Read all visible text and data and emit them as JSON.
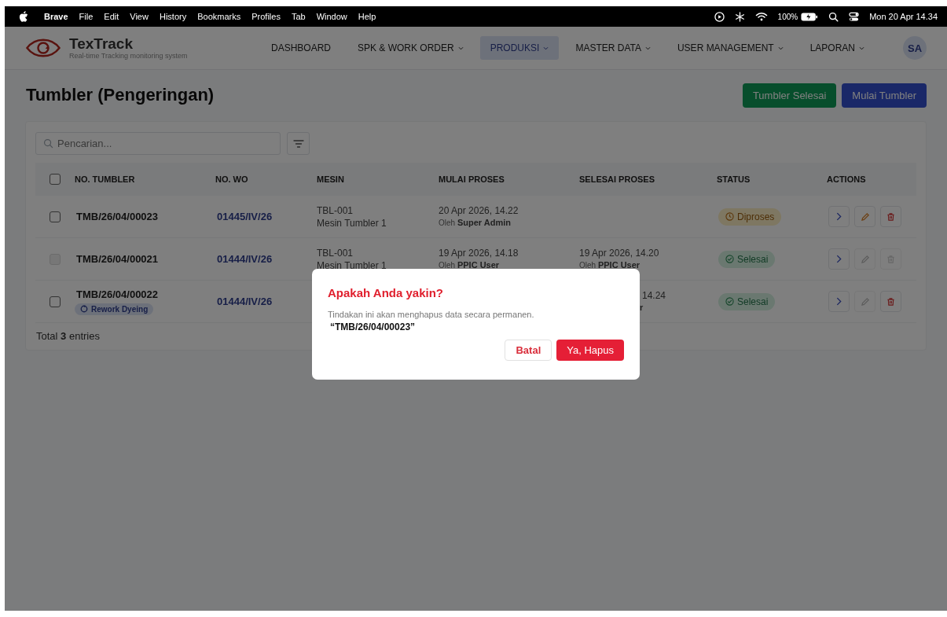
{
  "menubar": {
    "app": "Brave",
    "menus": [
      "File",
      "Edit",
      "View",
      "History",
      "Bookmarks",
      "Profiles",
      "Tab",
      "Window",
      "Help"
    ],
    "battery_text": "100%",
    "clock": "Mon 20 Apr 14.34"
  },
  "header": {
    "logo_title": "TexTrack",
    "logo_subtitle": "Real-time Tracking monitoring system",
    "nav": [
      {
        "label": "DASHBOARD",
        "dropdown": false,
        "selected": false
      },
      {
        "label": "SPK & WORK ORDER",
        "dropdown": true,
        "selected": false
      },
      {
        "label": "PRODUKSI",
        "dropdown": true,
        "selected": true
      },
      {
        "label": "MASTER DATA",
        "dropdown": true,
        "selected": false
      },
      {
        "label": "USER MANAGEMENT",
        "dropdown": true,
        "selected": false
      },
      {
        "label": "LAPORAN",
        "dropdown": true,
        "selected": false
      }
    ],
    "avatar": "SA"
  },
  "page": {
    "title": "Tumbler (Pengeringan)",
    "buttons": [
      {
        "label": "Tumbler Selesai",
        "kind": "success"
      },
      {
        "label": "Mulai Tumbler",
        "kind": "primary"
      }
    ]
  },
  "search": {
    "placeholder": "Pencarian..."
  },
  "table": {
    "select_all_checked": false,
    "columns": [
      "NO. TUMBLER",
      "NO. WO",
      "MESIN",
      "MULAI PROSES",
      "SELESAI PROSES",
      "STATUS",
      "ACTIONS"
    ],
    "rows": [
      {
        "checkbox_disabled": false,
        "no": "TMB/26/04/00023",
        "wo": "01445/IV/26",
        "mesin_code": "TBL-001",
        "mesin_name": "Mesin Tumbler 1",
        "mulai": {
          "date": "20 Apr 2026, 14.22",
          "by_prefix": "Oleh",
          "by": "Super Admin"
        },
        "status": {
          "label": "Diproses",
          "kind": "processing"
        },
        "edit_disabled": false,
        "delete_disabled": false
      },
      {
        "checkbox_disabled": true,
        "no": "TMB/26/04/00021",
        "wo": "01444/IV/26",
        "mesin_code": "TBL-001",
        "mesin_name": "Mesin Tumbler 1",
        "mulai": {
          "date": "19 Apr 2026, 14.18",
          "by_prefix": "Oleh",
          "by": "PPIC User"
        },
        "selesai": {
          "date": "19 Apr 2026, 14.20",
          "by_prefix": "Oleh",
          "by": "PPIC User"
        },
        "status": {
          "label": "Selesai",
          "kind": "done"
        },
        "edit_disabled": true,
        "delete_disabled": true
      },
      {
        "checkbox_disabled": false,
        "no": "TMB/26/04/00022",
        "tag": "Rework Dyeing",
        "wo": "01444/IV/26",
        "selesai_partial": {
          "date": "14.24",
          "by": "r"
        },
        "status": {
          "label": "Selesai",
          "kind": "done"
        },
        "edit_disabled": true,
        "delete_disabled": false
      }
    ]
  },
  "total": {
    "prefix": "Total",
    "count": "3",
    "suffix": "entries"
  },
  "dialog": {
    "title": "Apakah Anda yakin?",
    "message": "Tindakan ini akan menghapus data secara permanen.",
    "item": "“TMB/26/04/00023”",
    "cancel": "Batal",
    "confirm": "Ya, Hapus"
  }
}
